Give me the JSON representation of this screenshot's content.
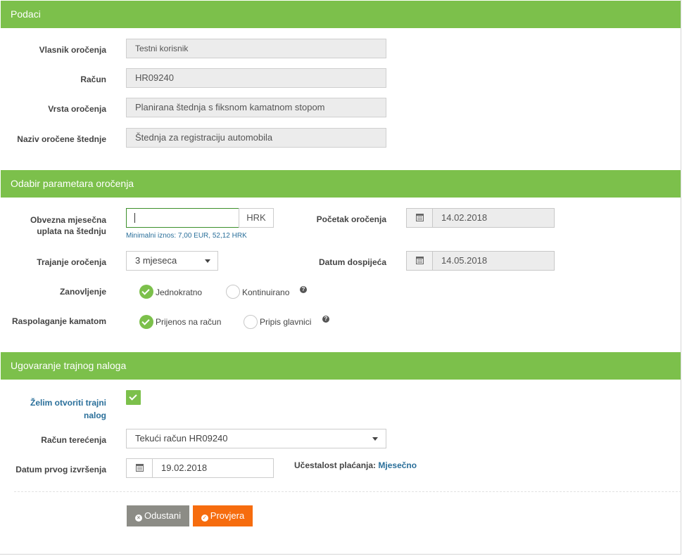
{
  "sections": {
    "podaci": "Podaci",
    "parametri": "Odabir parametara oročenja",
    "nalog": "Ugovaranje trajnog naloga"
  },
  "podaci": {
    "vlasnik_label": "Vlasnik oročenja",
    "vlasnik_value": "Testni korisnik",
    "racun_label": "Račun",
    "racun_value": "HR09240",
    "vrsta_label": "Vrsta oročenja",
    "vrsta_value": "Planirana štednja s fiksnom kamatnom stopom",
    "naziv_label": "Naziv oročene štednje",
    "naziv_value": "Štednja za registraciju automobila"
  },
  "parametri": {
    "uplata_label_1": "Obvezna mjesečna",
    "uplata_label_2": "uplata na štednju",
    "uplata_value": "",
    "currency": "HRK",
    "min_hint": "Minimalni iznos: 7,00 EUR, 52,12 HRK",
    "pocetak_label": "Početak oročenja",
    "pocetak_value": "14.02.2018",
    "trajanje_label": "Trajanje oročenja",
    "trajanje_value": "3 mjeseca",
    "dospijece_label": "Datum dospijeća",
    "dospijece_value": "14.05.2018",
    "zanovljenje_label": "Zanovljenje",
    "zanovljenje_opt1": "Jednokratno",
    "zanovljenje_opt2": "Kontinuirano",
    "zanovljenje_selected": "Jednokratno",
    "kamata_label": "Raspolaganje kamatom",
    "kamata_opt1": "Prijenos na račun",
    "kamata_opt2": "Pripis glavnici",
    "kamata_selected": "Prijenos na račun",
    "help_glyph": "?"
  },
  "nalog": {
    "zelim_label_1": "Želim otvoriti trajni",
    "zelim_label_2": "nalog",
    "zelim_checked": true,
    "terecenje_label": "Račun terećenja",
    "terecenje_value": "Tekući račun HR09240",
    "datum_label": "Datum prvog izvršenja",
    "datum_value": "19.02.2018",
    "ucestalost_label": "Učestalost plaćanja:",
    "ucestalost_value": "Mjesečno"
  },
  "buttons": {
    "odustani": "Odustani",
    "provjera": "Provjera"
  },
  "colors": {
    "header_green": "#7cc04b",
    "cancel_gray": "#8c8c86",
    "submit_orange": "#f66c0e",
    "link_blue": "#2a6f9a"
  },
  "icons": {
    "calendar": "calendar-icon",
    "caret": "caret-down-icon",
    "check": "check-icon",
    "help": "question-circle-icon",
    "cancel": "times-circle-icon",
    "ok": "check-circle-icon"
  }
}
